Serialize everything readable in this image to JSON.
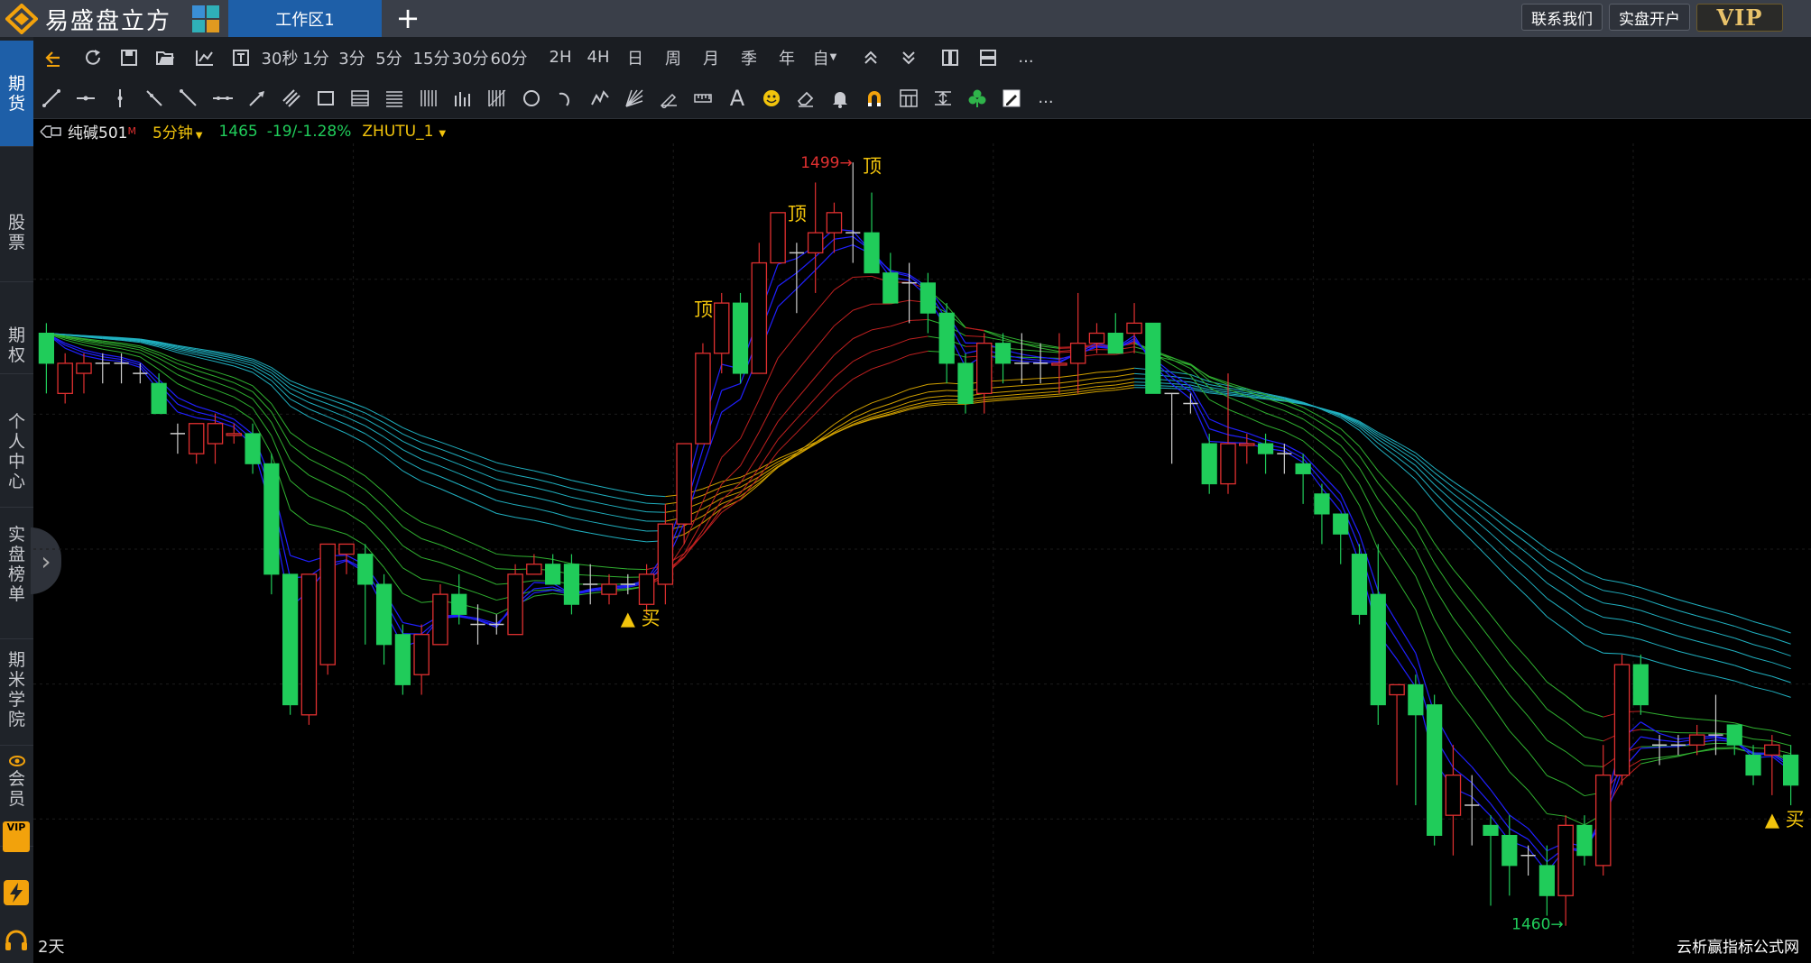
{
  "app": {
    "name": "易盛盘立方",
    "tab_label": "工作区1",
    "contact_label": "联系我们",
    "open_account_label": "实盘开户",
    "vip_label": "VIP"
  },
  "sidebar": {
    "items": [
      {
        "label": "期货",
        "active": true
      },
      {
        "label": "股票",
        "active": false
      },
      {
        "label": "期权",
        "active": false
      },
      {
        "label": "个人中心",
        "active": false
      },
      {
        "label": "实盘榜单",
        "active": false
      },
      {
        "label": "期米学院",
        "active": false
      },
      {
        "label": "会员",
        "active": false
      }
    ],
    "vip_icon": "VIP",
    "lightning_icon": "lightning-icon",
    "headset_icon": "headset-icon"
  },
  "toolbar": {
    "periods": [
      "30秒",
      "1分",
      "3分",
      "5分",
      "15分",
      "30分",
      "60分",
      "2H",
      "4H",
      "日",
      "周",
      "月",
      "季",
      "年",
      "自"
    ],
    "more_label": "...",
    "text_tool_label": "A"
  },
  "infobar": {
    "symbol": "纯碱501",
    "symbol_flag": "M",
    "period": "5分钟",
    "price": "1465",
    "change": "-19/-1.28%",
    "indicator": "ZHUTU_1"
  },
  "chart_data": {
    "type": "candlestick",
    "high_label": "1499",
    "low_label": "1460",
    "signal_top": "顶",
    "signal_buy": "买",
    "period_label": "2天",
    "watermark": "云析赢指标公式网",
    "colors": {
      "up": "#e03030",
      "down": "#20cc5a",
      "cross": "#cccccc",
      "fast_ma": "#2020ff",
      "ribbon_up": "#c02020",
      "ribbon_down": "#30b030",
      "slow_ribbon_up": "#d0a000",
      "slow_ribbon_down": "#20b0c0"
    },
    "candles": [
      [
        1479,
        1482,
        1476,
        1483,
        "down"
      ],
      [
        1476,
        1479,
        1475,
        1480,
        "up"
      ],
      [
        1478,
        1479,
        1476,
        1480,
        "up"
      ],
      [
        1479,
        1479,
        1477,
        1480,
        "cross"
      ],
      [
        1479,
        1479,
        1477,
        1480,
        "cross"
      ],
      [
        1478,
        1478,
        1477,
        1479,
        "cross"
      ],
      [
        1477,
        1474,
        1474,
        1478,
        "down"
      ],
      [
        1472,
        1472,
        1470,
        1473,
        "cross"
      ],
      [
        1470,
        1473,
        1469,
        1473,
        "up"
      ],
      [
        1471,
        1473,
        1469,
        1474,
        "up"
      ],
      [
        1472,
        1472,
        1471,
        1473,
        "up"
      ],
      [
        1472,
        1469,
        1468,
        1473,
        "down"
      ],
      [
        1469,
        1458,
        1456,
        1470,
        "down"
      ],
      [
        1458,
        1445,
        1444,
        1458,
        "down"
      ],
      [
        1444,
        1458,
        1443,
        1458,
        "up"
      ],
      [
        1449,
        1461,
        1448,
        1461,
        "up"
      ],
      [
        1461,
        1460,
        1458,
        1461,
        "up"
      ],
      [
        1460,
        1457,
        1451,
        1461,
        "down"
      ],
      [
        1457,
        1451,
        1449,
        1458,
        "down"
      ],
      [
        1452,
        1447,
        1446,
        1453,
        "down"
      ],
      [
        1448,
        1452,
        1446,
        1453,
        "up"
      ],
      [
        1451,
        1456,
        1451,
        1457,
        "up"
      ],
      [
        1456,
        1454,
        1453,
        1458,
        "down"
      ],
      [
        1453,
        1453,
        1451,
        1455,
        "cross"
      ],
      [
        1453,
        1452,
        1452,
        1454,
        "cross"
      ],
      [
        1452,
        1458,
        1452,
        1459,
        "up"
      ],
      [
        1458,
        1459,
        1458,
        1460,
        "up"
      ],
      [
        1459,
        1457,
        1457,
        1460,
        "down"
      ],
      [
        1459,
        1455,
        1454,
        1460,
        "down"
      ],
      [
        1457,
        1457,
        1455,
        1459,
        "cross"
      ],
      [
        1456,
        1457,
        1455,
        1458,
        "up"
      ],
      [
        1457,
        1457,
        1456,
        1458,
        "cross"
      ],
      [
        1455,
        1458,
        1454,
        1459,
        "up"
      ],
      [
        1457,
        1463,
        1455,
        1465,
        "up"
      ],
      [
        1463,
        1471,
        1461,
        1471,
        "up"
      ],
      [
        1471,
        1480,
        1471,
        1481,
        "up"
      ],
      [
        1480,
        1485,
        1478,
        1486,
        "up"
      ],
      [
        1485,
        1478,
        1477,
        1486,
        "down"
      ],
      [
        1478,
        1489,
        1478,
        1491,
        "up"
      ],
      [
        1489,
        1494,
        1489,
        1494,
        "up"
      ],
      [
        1489,
        1490,
        1484,
        1491,
        "cross"
      ],
      [
        1490,
        1492,
        1486,
        1497,
        "up"
      ],
      [
        1492,
        1494,
        1490,
        1495,
        "up"
      ],
      [
        1492,
        1492,
        1489,
        1499,
        "cross"
      ],
      [
        1492,
        1488,
        1489,
        1496,
        "down"
      ],
      [
        1488,
        1485,
        1485,
        1490,
        "down"
      ],
      [
        1487,
        1487,
        1483,
        1489,
        "cross"
      ],
      [
        1487,
        1484,
        1482,
        1488,
        "down"
      ],
      [
        1484,
        1479,
        1477,
        1485,
        "down"
      ],
      [
        1479,
        1475,
        1474,
        1480,
        "down"
      ],
      [
        1476,
        1481,
        1474,
        1482,
        "up"
      ],
      [
        1481,
        1479,
        1477,
        1482,
        "down"
      ],
      [
        1479,
        1479,
        1477,
        1482,
        "cross"
      ],
      [
        1479,
        1479,
        1477,
        1481,
        "cross"
      ],
      [
        1479,
        1479,
        1476,
        1482,
        "up"
      ],
      [
        1479,
        1481,
        1476,
        1486,
        "up"
      ],
      [
        1481,
        1482,
        1480,
        1483,
        "up"
      ],
      [
        1482,
        1480,
        1480,
        1484,
        "down"
      ],
      [
        1482,
        1483,
        1480,
        1485,
        "up"
      ],
      [
        1483,
        1476,
        1476,
        1483,
        "down"
      ],
      [
        1476,
        1475,
        1469,
        1476,
        "cross"
      ],
      [
        1475,
        1474,
        1474,
        1476,
        "cross"
      ],
      [
        1471,
        1467,
        1466,
        1472,
        "down"
      ],
      [
        1467,
        1471,
        1466,
        1478,
        "up"
      ],
      [
        1471,
        1471,
        1469,
        1472,
        "up"
      ],
      [
        1471,
        1470,
        1468,
        1472,
        "down"
      ],
      [
        1470,
        1470,
        1468,
        1471,
        "cross"
      ],
      [
        1469,
        1468,
        1465,
        1470,
        "down"
      ],
      [
        1466,
        1464,
        1461,
        1467,
        "down"
      ],
      [
        1464,
        1462,
        1459,
        1464,
        "down"
      ],
      [
        1460,
        1454,
        1453,
        1461,
        "down"
      ],
      [
        1456,
        1445,
        1443,
        1461,
        "down"
      ],
      [
        1446,
        1447,
        1437,
        1447,
        "up"
      ],
      [
        1447,
        1444,
        1435,
        1448,
        "down"
      ],
      [
        1445,
        1432,
        1431,
        1446,
        "down"
      ],
      [
        1438,
        1434,
        1430,
        1441,
        "up"
      ],
      [
        1435,
        1435,
        1431,
        1438,
        "cross"
      ],
      [
        1433,
        1432,
        1425,
        1434,
        "down"
      ],
      [
        1432,
        1429,
        1426,
        1434,
        "down"
      ],
      [
        1430,
        1430,
        1428,
        1431,
        "cross"
      ],
      [
        1429,
        1426,
        1424,
        1431,
        "down"
      ],
      [
        1426,
        1433,
        1423,
        1434,
        "up"
      ],
      [
        1433,
        1430,
        1429,
        1434,
        "down"
      ],
      [
        1429,
        1438,
        1428,
        1441,
        "up"
      ],
      [
        1438,
        1449,
        1437,
        1450,
        "up"
      ],
      [
        1449,
        1445,
        1444,
        1450,
        "down"
      ],
      [
        1441,
        1441,
        1439,
        1442,
        "cross"
      ],
      [
        1441,
        1441,
        1440,
        1442,
        "cross"
      ],
      [
        1441,
        1442,
        1440,
        1443,
        "up"
      ],
      [
        1442,
        1442,
        1440,
        1446,
        "cross"
      ],
      [
        1443,
        1441,
        1440,
        1443,
        "down"
      ],
      [
        1440,
        1438,
        1437,
        1441,
        "down"
      ],
      [
        1441,
        1440,
        1436,
        1442,
        "up"
      ],
      [
        1440,
        1437,
        1435,
        1441,
        "down"
      ]
    ]
  }
}
